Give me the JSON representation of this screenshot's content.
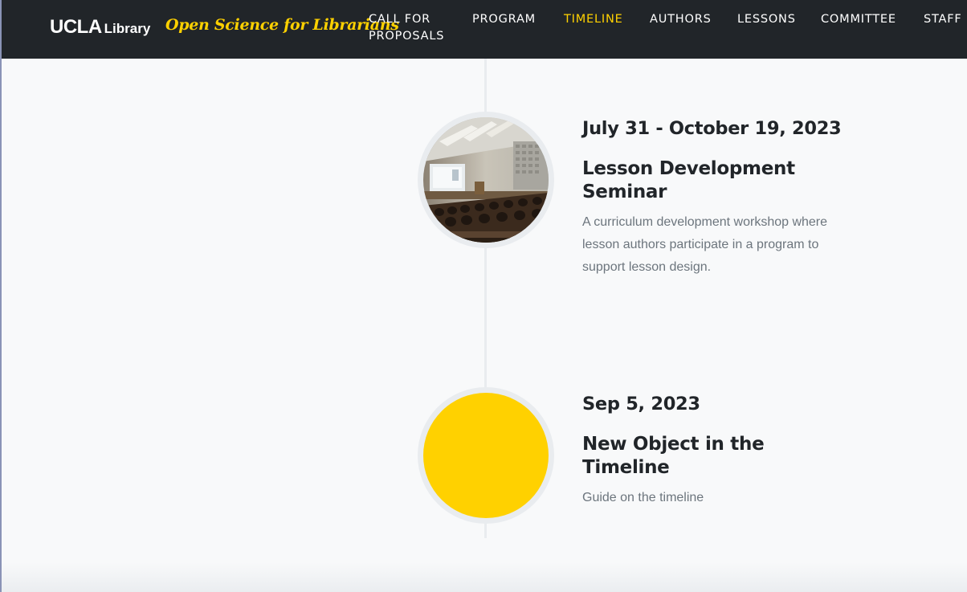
{
  "brand": {
    "ucla": "UCLA",
    "library": "Library",
    "tagline": "Open Science for Librarians"
  },
  "nav": {
    "items": [
      {
        "label": "CALL FOR PROPOSALS"
      },
      {
        "label": "PROGRAM"
      },
      {
        "label": "TIMELINE"
      },
      {
        "label": "AUTHORS"
      },
      {
        "label": "LESSONS"
      },
      {
        "label": "COMMITTEE"
      },
      {
        "label": "STAFF"
      }
    ],
    "active": "TIMELINE"
  },
  "timeline": {
    "items": [
      {
        "date": "July 31 - October 19, 2023",
        "title": "Lesson Development Seminar",
        "description": "A curriculum development workshop where lesson authors participate in a program to support lesson design.",
        "image": "lecture-hall-photo"
      },
      {
        "date": "Sep 5, 2023",
        "title": "New Object in the Timeline",
        "description": "Guide on the timeline",
        "image": "yellow-circle"
      }
    ]
  },
  "colors": {
    "navbar_bg": "#212529",
    "accent": "#ffd100",
    "text_dark": "#212529",
    "text_muted": "#6c757d",
    "page_bg": "#f8f9fa"
  }
}
